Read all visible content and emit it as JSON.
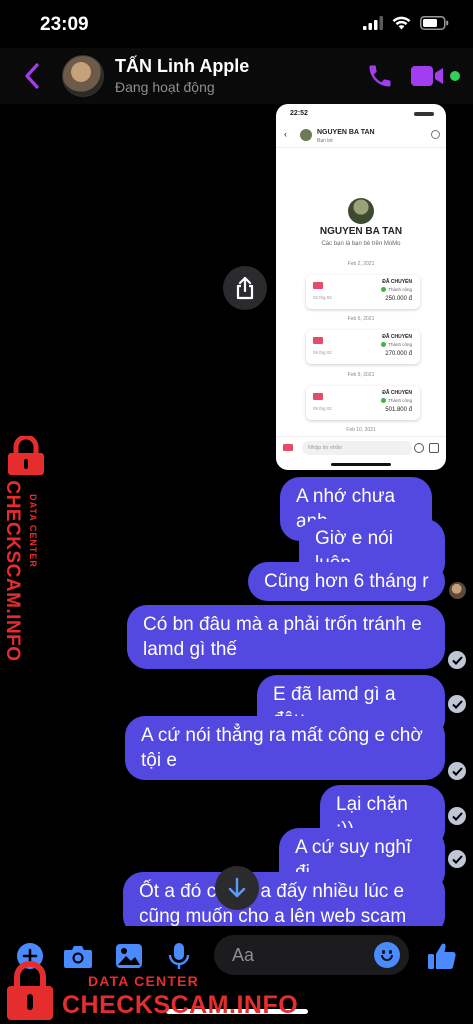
{
  "status_bar": {
    "time": "23:09"
  },
  "header": {
    "contact_name": "TẤN Linh Apple",
    "contact_status": "Đang hoạt động"
  },
  "shared_screenshot": {
    "time": "22:52",
    "contact_name": "NGUYEN BA TAN",
    "contact_sub": "Bạn bè",
    "profile_name": "NGUYEN BA TAN",
    "profile_desc": "Các bạn là bạn bè trên MoMo",
    "transfers": [
      {
        "date": "Feb 2, 2021",
        "title": "ĐÃ CHUYỂN",
        "state": "Thành công",
        "amount": "250.000 đ",
        "sub": "02 thg 02"
      },
      {
        "date": "Feb 6, 2021",
        "title": "ĐÃ CHUYỂN",
        "state": "Thành công",
        "amount": "270.000 đ",
        "sub": "06 thg 02"
      },
      {
        "date": "Feb 9, 2021",
        "title": "ĐÃ CHUYỂN",
        "state": "Thành công",
        "amount": "501.800 đ",
        "sub": "09 thg 02"
      }
    ],
    "last_date": "Feb 10, 2021",
    "input_placeholder": "Nhập tin nhắn"
  },
  "messages": [
    {
      "text": "A nhớ chưa anh"
    },
    {
      "text": "Giờ e nói luôn"
    },
    {
      "text": "Cũng hơn 6 tháng r"
    },
    {
      "text": "Có bn đâu mà a phải trốn tránh e lamd gì thế"
    },
    {
      "text": "E đã lamd gì a đâu"
    },
    {
      "text": "A cứ nói thẳng ra mất công e chờ tội e"
    },
    {
      "text": "Lại chặn :))"
    },
    {
      "text": "A cứ suy nghĩ đi"
    },
    {
      "text": "Ốt a đó c  việc a đấy nhiều lúc e cũng muốn cho a lên web scam"
    }
  ],
  "composer": {
    "placeholder": "Aa"
  },
  "watermark": {
    "label": "DATA CENTER",
    "url": "CHECKSCAM.INFO"
  },
  "colors": {
    "accent": "#a33df0",
    "bubble": "#5348e0",
    "watermark": "#e52d2d",
    "online": "#31d158"
  }
}
